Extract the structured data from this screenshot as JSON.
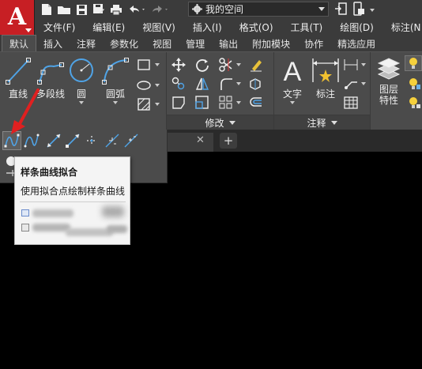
{
  "app": {
    "logo_letter": "A"
  },
  "workspace": {
    "label": "我的空间"
  },
  "menu": [
    "文件(F)",
    "编辑(E)",
    "视图(V)",
    "插入(I)",
    "格式(O)",
    "工具(T)",
    "绘图(D)",
    "标注(N"
  ],
  "ribbon_tabs": [
    "默认",
    "插入",
    "注释",
    "参数化",
    "视图",
    "管理",
    "输出",
    "附加模块",
    "协作",
    "精选应用"
  ],
  "active_tab": "默认",
  "draw_tools": {
    "line": "直线",
    "polyline": "多段线",
    "circle": "圆",
    "arc": "圆弧"
  },
  "panels": {
    "modify": "修改",
    "annotation": "注释"
  },
  "annotation_tools": {
    "text": "文字",
    "dimension": "标注"
  },
  "layers_tool": {
    "line1": "图层",
    "line2": "特性"
  },
  "tooltip": {
    "title": "样条曲线拟合",
    "description": "使用拟合点绘制样条曲线"
  },
  "colors": {
    "app_red": "#c71f24",
    "ribbon_bg": "#4b4b4b",
    "title_bg": "#3b3b3b",
    "arrow_red": "#e02020"
  }
}
